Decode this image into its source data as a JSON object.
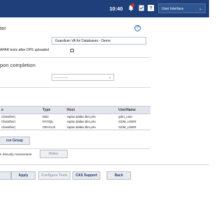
{
  "topbar": {
    "time": "10:40",
    "user_interface_label": "User Interface",
    "icons": [
      "bell-icon",
      "check-icon",
      "help-icon",
      "chevron-down-icon"
    ],
    "notification_color": "#e0301e"
  },
  "section1": {
    "title": "ter",
    "name_value": "Guardium VA for Databases - Demo",
    "checkbox_label": "APAR tests after DPS uploaded"
  },
  "section2": {
    "title": "pon completion",
    "select_value": "-------------"
  },
  "table": {
    "headers": [
      "e",
      "Type",
      "Host",
      "UserName"
    ],
    "rows": [
      [
        "Classifier)",
        "DB2",
        "raptor.dallas.ibm.priv",
        "gdm_user"
      ],
      [
        "Classifier)",
        "MYSQL",
        "raptor.dallas.ibm.priv",
        "GDM_USER"
      ],
      [
        "Classifier)",
        "ORACLE",
        "raptor.dallas.ibm.priv",
        "GDM_USER"
      ]
    ]
  },
  "buttons": {
    "source_group": "rce Group",
    "roles": "Roles",
    "apply": "Apply",
    "configure_tests": "Configure Tests",
    "cas_support": "CAS Support",
    "back": "Back"
  },
  "labels": {
    "security_assessment": "s Security Assessment"
  },
  "colors": {
    "header_bg": "#1f3f7a",
    "accent": "#1f61a8"
  }
}
